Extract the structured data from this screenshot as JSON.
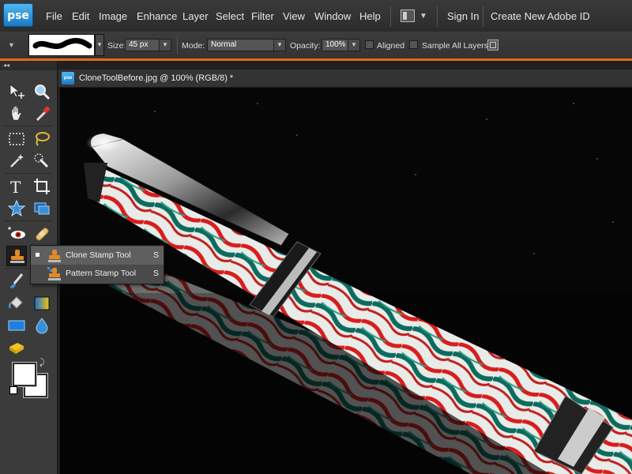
{
  "app": {
    "logo": "pse"
  },
  "menu": {
    "items": [
      "File",
      "Edit",
      "Image",
      "Enhance",
      "Layer",
      "Select",
      "Filter",
      "View",
      "Window",
      "Help"
    ],
    "sign_in": "Sign In",
    "create_id": "Create New Adobe ID"
  },
  "options": {
    "size_label": "Size:",
    "size_value": "45 px",
    "mode_label": "Mode:",
    "mode_value": "Normal",
    "opacity_label": "Opacity:",
    "opacity_value": "100%",
    "aligned_label": "Aligned",
    "sample_all_label": "Sample All Layers"
  },
  "document": {
    "title": "CloneToolBefore.jpg @ 100% (RGB/8) *",
    "tab_icon": "pse"
  },
  "flyout": {
    "items": [
      {
        "label": "Clone Stamp Tool",
        "shortcut": "S",
        "selected": true
      },
      {
        "label": "Pattern Stamp Tool",
        "shortcut": "S",
        "selected": false
      }
    ]
  },
  "toolbox": {
    "collapse_glyph": "◂◂",
    "tools": [
      "move-tool",
      "zoom-tool",
      "hand-tool",
      "eyedropper-tool",
      "rectangular-marquee-tool",
      "lasso-tool",
      "magic-wand-tool",
      "quick-selection-tool",
      "type-tool",
      "crop-tool",
      "cookie-cutter-tool",
      "straighten-tool",
      "red-eye-removal-tool",
      "spot-healing-brush-tool",
      "clone-stamp-tool",
      "brush-tool",
      "eraser-tool",
      "paint-bucket-tool",
      "gradient-tool",
      "rectangle-shape-tool",
      "blur-tool",
      "sponge-tool"
    ]
  }
}
